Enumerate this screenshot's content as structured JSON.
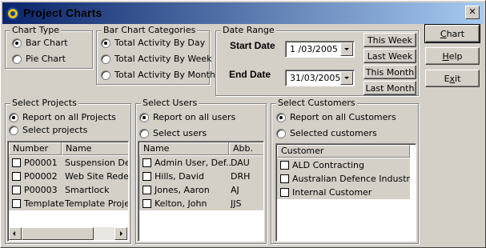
{
  "window": {
    "title": "Project Charts",
    "close_glyph": "✕"
  },
  "chart_type": {
    "legend": "Chart Type",
    "options": [
      {
        "label": "Bar Chart",
        "checked": true
      },
      {
        "label": "Pie Chart",
        "checked": false
      }
    ]
  },
  "bar_categories": {
    "legend": "Bar Chart Categories",
    "options": [
      {
        "label": "Total Activity By Day",
        "checked": true
      },
      {
        "label": "Total Activity By Week",
        "checked": false
      },
      {
        "label": "Total Activity By Month",
        "checked": false
      }
    ]
  },
  "date_range": {
    "legend": "Date Range",
    "start_label": "Start Date",
    "start_value": "1 /03/2005",
    "end_label": "End Date",
    "end_value": "31/03/2005",
    "buttons": [
      "This Week",
      "Last Week",
      "This Month",
      "Last Month"
    ]
  },
  "actions": {
    "chart": {
      "pre": "",
      "u": "C",
      "post": "hart"
    },
    "help": {
      "pre": "",
      "u": "H",
      "post": "elp"
    },
    "exit": {
      "pre": "E",
      "u": "x",
      "post": "it"
    }
  },
  "projects": {
    "legend": "Select Projects",
    "opt_all": "Report on all Projects",
    "opt_select": "Select projects",
    "columns": [
      "Number",
      "Name"
    ],
    "rows": [
      [
        "P00001",
        "Suspension Design"
      ],
      [
        "P00002",
        "Web Site Redesign"
      ],
      [
        "P00003",
        "Smartlock"
      ],
      [
        "Template",
        "Template Project"
      ]
    ]
  },
  "users": {
    "legend": "Select Users",
    "opt_all": "Report on all users",
    "opt_select": "Select users",
    "columns": [
      "Name",
      "Abb."
    ],
    "rows": [
      [
        "Admin User, Def...",
        "DAU"
      ],
      [
        "Hills, David",
        "DRH"
      ],
      [
        "Jones, Aaron",
        "AJ"
      ],
      [
        "Kelton, John",
        "JJS"
      ]
    ]
  },
  "customers": {
    "legend": "Select Customers",
    "opt_all": "Report on all Customers",
    "opt_select": "Selected customers",
    "columns": [
      "Customer"
    ],
    "rows": [
      [
        "ALD Contracting"
      ],
      [
        "Australian Defence Industries"
      ],
      [
        "Internal Customer"
      ]
    ]
  }
}
